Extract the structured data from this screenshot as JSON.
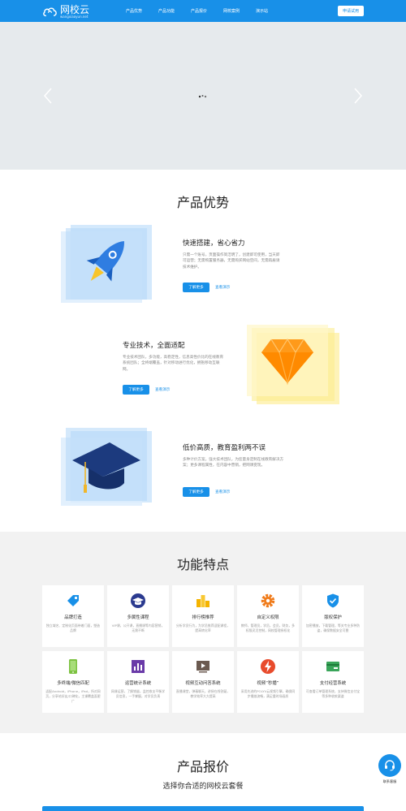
{
  "header": {
    "logo_title": "网校云",
    "logo_sub": "wangxiaoyun.net",
    "nav": [
      "产品优势",
      "产品功能",
      "产品报价",
      "网校案例",
      "演示站"
    ],
    "cta": "申请试用"
  },
  "advantages": {
    "title": "产品优势",
    "items": [
      {
        "heading": "快速搭建，省心省力",
        "desc": "只需一个账号，页面操作简洁明了，创建即可使用，当天即可运营；无需购置服务器，无需购买网站空间，无需再雇请技术维护。",
        "more": "了解更多",
        "demo": "查看演示"
      },
      {
        "heading": "专业技术，全面适配",
        "desc": "专业技术团队，多功能，高稳定性，信息高性价比的在线教育系统团队；全终端覆盖，针对移动进行优化，拥抱移动互联网。",
        "more": "了解更多",
        "demo": "查看演示"
      },
      {
        "heading": "低价高质，教育盈利两不误",
        "desc": "多种计价方案，强大技术团队，为您量身定制在线教育解决方案；更多课程属性，在内容中营销，把网课变现。",
        "more": "了解更多",
        "demo": "查看演示"
      }
    ]
  },
  "features": {
    "title": "功能特点",
    "cards": [
      {
        "title": "品牌打造",
        "desc": "独立域名、定制化页面带着门面，塑造品牌",
        "icon": "tag-icon"
      },
      {
        "title": "多属性课程",
        "desc": "VIP课，公开课，直播课等内容营销，无需不断",
        "icon": "graduation-cap-icon"
      },
      {
        "title": "排行榜推荐",
        "desc": "分析学员行为，为学员推荐适配课程，提高转化率",
        "icon": "ranking-icon"
      },
      {
        "title": "自定义权限",
        "desc": "教师，管理员，学员，会员，财务，多权限灵活控制，网校管理授权化",
        "icon": "gear-icon"
      },
      {
        "title": "版权保护",
        "desc": "加密播放，下载管理，等关专业多种防盗，确保数据安全可靠",
        "icon": "shield-icon"
      },
      {
        "title": "多终端/微信匹配",
        "desc": "适配Android，iPhone，iPad，所对网页，分享给好友/口碑化，主课覆盖面更广",
        "icon": "mobile-icon"
      },
      {
        "title": "运营统计系统",
        "desc": "网课运营，了解销量，监控收支平衡学员信息，一手掌握，对学员负责",
        "icon": "chart-icon"
      },
      {
        "title": "视频互动问答系统",
        "desc": "直播课堂，弹幕聊天，讲授在线答疑，教学效率大大提高",
        "icon": "video-play-icon"
      },
      {
        "title": "视频“秒播”",
        "desc": "采用先进的POLYV云视频引擎，确保同步播放流畅，满足重时场画质",
        "icon": "lightning-icon"
      },
      {
        "title": "支付经营系统",
        "desc": "可查看订单管理系统，支持微信支付宝等多种收款渠道",
        "icon": "wallet-icon"
      }
    ]
  },
  "pricing": {
    "title": "产品报价",
    "subtitle": "选择你合适的网校云套餐"
  },
  "contact": {
    "label": "联系客服"
  },
  "colors": {
    "primary": "#1890e8",
    "banner": "#e6eaed",
    "features_bg": "#f2f2f2"
  }
}
